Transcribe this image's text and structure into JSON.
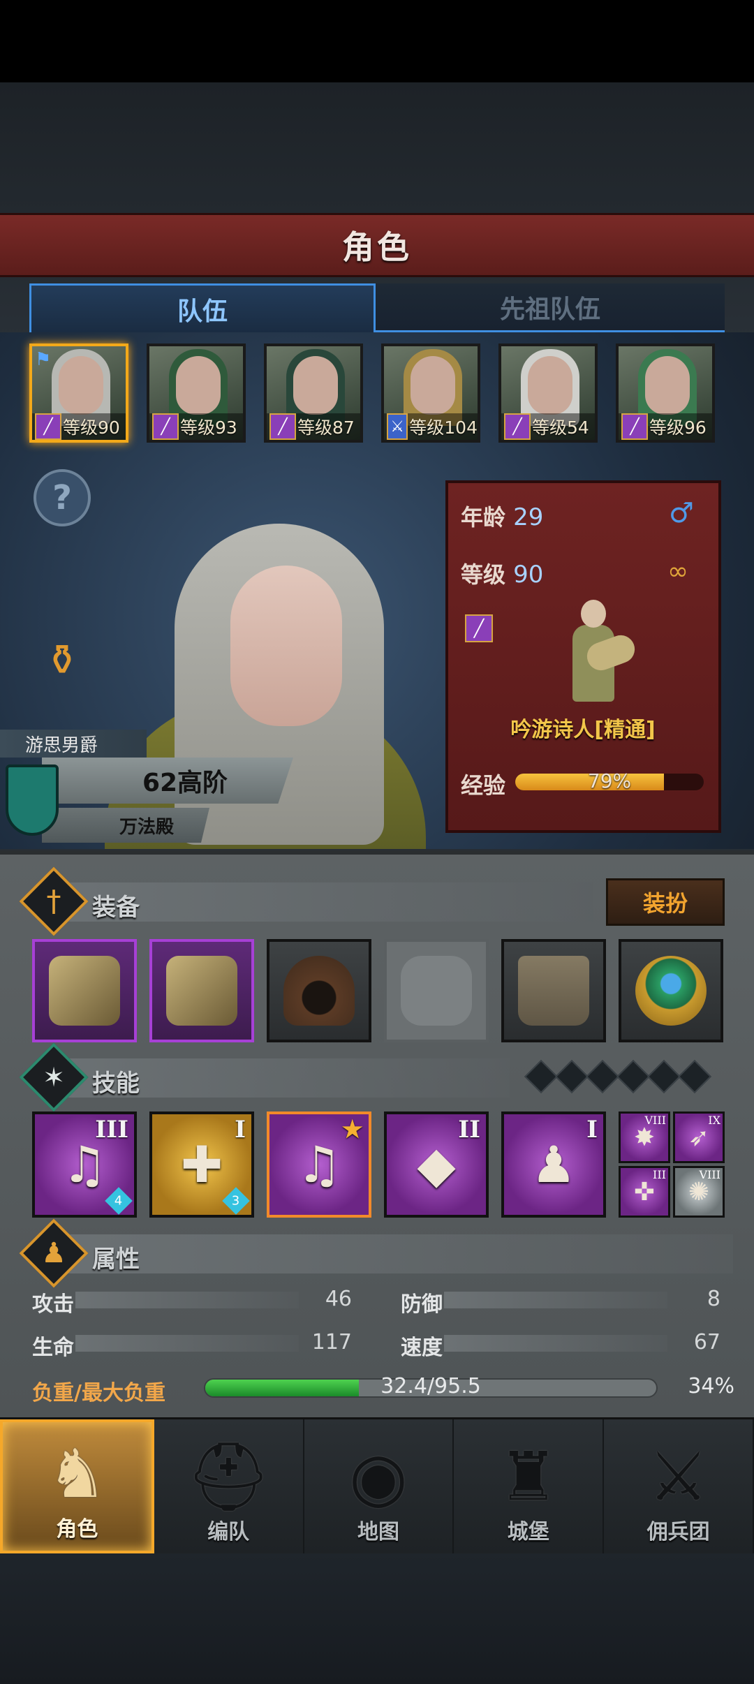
{
  "header": {
    "title": "角色"
  },
  "tabs": [
    {
      "label": "队伍",
      "active": true
    },
    {
      "label": "先祖队伍",
      "active": false
    }
  ],
  "party": [
    {
      "level_text": "等级90",
      "class_icon": "staff-icon",
      "selected": true,
      "flag": true
    },
    {
      "level_text": "等级93",
      "class_icon": "staff-icon"
    },
    {
      "level_text": "等级87",
      "class_icon": "staff-icon"
    },
    {
      "level_text": "等级104",
      "class_icon": "sword-icon"
    },
    {
      "level_text": "等级54",
      "class_icon": "staff-icon"
    },
    {
      "level_text": "等级96",
      "class_icon": "staff-icon"
    }
  ],
  "hero": {
    "title": "游思男爵",
    "rank": "62高阶",
    "guild": "万法殿"
  },
  "info": {
    "age_label": "年龄",
    "age": "29",
    "level_label": "等级",
    "level": "90",
    "class_name": "吟游诗人[精通]",
    "exp_label": "经验",
    "exp_text": "79%",
    "exp_fraction": 0.79
  },
  "equipment": {
    "title": "装备",
    "dress_button": "装扮"
  },
  "skills": {
    "title": "技能",
    "main": [
      {
        "roman": "III",
        "glyph": "♫",
        "gem": "4",
        "style": "purple"
      },
      {
        "roman": "I",
        "glyph": "✚",
        "gem": "3",
        "style": "gold"
      },
      {
        "roman": "★",
        "glyph": "♫",
        "gem": "",
        "style": "purple",
        "selected": true
      },
      {
        "roman": "II",
        "glyph": "◆",
        "gem": "",
        "style": "purple"
      },
      {
        "roman": "I",
        "glyph": "♟",
        "gem": "",
        "style": "purple"
      }
    ],
    "minis": [
      {
        "roman": "VIII",
        "glyph": "✸"
      },
      {
        "roman": "IX",
        "glyph": "➶"
      },
      {
        "roman": "III",
        "glyph": "✜"
      },
      {
        "roman": "VIII",
        "glyph": "✺"
      }
    ]
  },
  "attributes": {
    "title": "属性",
    "stats": [
      {
        "label": "攻击",
        "value": "46"
      },
      {
        "label": "防御",
        "value": "8"
      },
      {
        "label": "生命",
        "value": "117"
      },
      {
        "label": "速度",
        "value": "67"
      }
    ],
    "load_label": "负重/最大负重",
    "load_text": "32.4/95.5",
    "load_fraction": 0.34,
    "load_pct": "34%"
  },
  "nav": [
    {
      "label": "角色",
      "icon": "knight-icon",
      "active": true
    },
    {
      "label": "编队",
      "icon": "helmet-icon"
    },
    {
      "label": "地图",
      "icon": "compass-map-icon"
    },
    {
      "label": "城堡",
      "icon": "castle-icon"
    },
    {
      "label": "佣兵团",
      "icon": "mercenary-icon"
    }
  ]
}
